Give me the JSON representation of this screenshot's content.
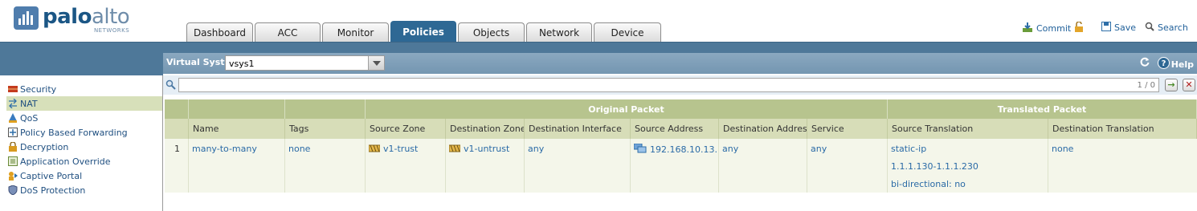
{
  "brand": {
    "name_part1": "palo",
    "name_part2": "alto",
    "subtitle": "NETWORKS"
  },
  "tabs": [
    {
      "label": "Dashboard",
      "active": false
    },
    {
      "label": "ACC",
      "active": false
    },
    {
      "label": "Monitor",
      "active": false
    },
    {
      "label": "Policies",
      "active": true
    },
    {
      "label": "Objects",
      "active": false
    },
    {
      "label": "Network",
      "active": false
    },
    {
      "label": "Device",
      "active": false
    }
  ],
  "toolbar": {
    "commit_label": "Commit",
    "save_label": "Save",
    "search_label": "Search"
  },
  "vsys": {
    "label": "Virtual System",
    "value": "vsys1",
    "help_label": "Help"
  },
  "filter": {
    "value": "",
    "count": "1 / 0"
  },
  "sidebar": {
    "items": [
      {
        "label": "Security",
        "icon": "security-rule-icon",
        "active": false
      },
      {
        "label": "NAT",
        "icon": "nat-icon",
        "active": true
      },
      {
        "label": "QoS",
        "icon": "qos-icon",
        "active": false
      },
      {
        "label": "Policy Based Forwarding",
        "icon": "pbf-icon",
        "active": false
      },
      {
        "label": "Decryption",
        "icon": "lock-icon",
        "active": false
      },
      {
        "label": "Application Override",
        "icon": "app-override-icon",
        "active": false
      },
      {
        "label": "Captive Portal",
        "icon": "captive-portal-icon",
        "active": false
      },
      {
        "label": "DoS Protection",
        "icon": "shield-icon",
        "active": false
      }
    ]
  },
  "table": {
    "groups": {
      "original": "Original Packet",
      "translated": "Translated Packet"
    },
    "columns": [
      "",
      "Name",
      "Tags",
      "Source Zone",
      "Destination Zone",
      "Destination Interface",
      "Source Address",
      "Destination Address",
      "Service",
      "Source Translation",
      "Destination Translation"
    ],
    "rows": [
      {
        "index": "1",
        "name": "many-to-many",
        "tags": "none",
        "source_zone": "v1-trust",
        "destination_zone": "v1-untrust",
        "destination_interface": "any",
        "source_address": "192.168.10.13...",
        "destination_address": "any",
        "service": "any",
        "source_translation": [
          "static-ip",
          "1.1.1.130-1.1.1.230",
          "bi-directional: no"
        ],
        "destination_translation": "none"
      }
    ]
  },
  "colors": {
    "accent": "#2e6894",
    "band": "#4e7899",
    "header_green": "#b7c48e",
    "link": "#2a6aa6"
  }
}
